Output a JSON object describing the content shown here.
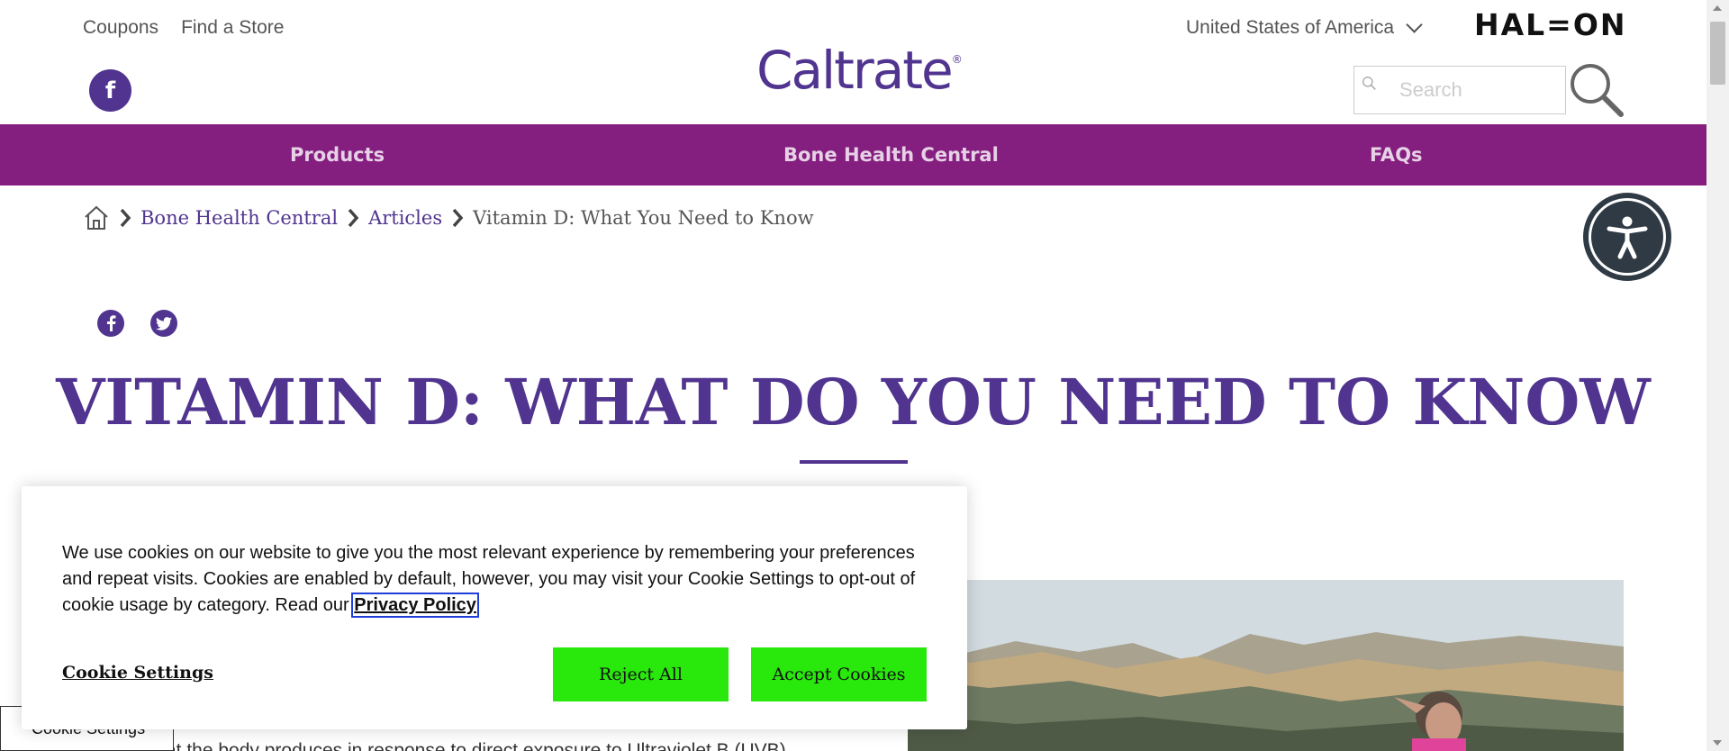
{
  "header": {
    "util_links": [
      "Coupons",
      "Find a Store"
    ],
    "logo_text": "Caltrate",
    "logo_mark": "®",
    "country": "United States of America",
    "brand": "HAL=ON",
    "search_placeholder": "Search",
    "social_icon": "facebook-icon"
  },
  "nav": {
    "items": [
      "Products",
      "Bone Health Central",
      "FAQs"
    ],
    "background": "#841e7f"
  },
  "breadcrumb": {
    "items": [
      "Bone Health Central",
      "Articles"
    ],
    "current": "Vitamin D: What You Need to Know"
  },
  "share": {
    "icons": [
      "facebook-icon",
      "twitter-icon"
    ]
  },
  "article": {
    "title": "VITAMIN D: WHAT DO YOU NEED TO KNOW",
    "body_fragment": "at the body produces in response to direct exposure to Ultraviolet B (UVB)",
    "image_alt": "woman hiking mountains"
  },
  "cookie": {
    "message": "We use cookies on our website to give you the most relevant experience by remembering your preferences and repeat visits. Cookies are enabled by default, however, you may visit your Cookie Settings to opt-out of cookie usage by category. Read our ",
    "privacy_label": "Privacy Policy",
    "settings_label": "Cookie Settings",
    "reject_label": "Reject All",
    "accept_label": "Accept Cookies",
    "floating_tab_label": "Cookie Settings",
    "button_color": "#29e80c"
  },
  "colors": {
    "brand_purple": "#50348f",
    "nav_magenta": "#841e7f"
  }
}
